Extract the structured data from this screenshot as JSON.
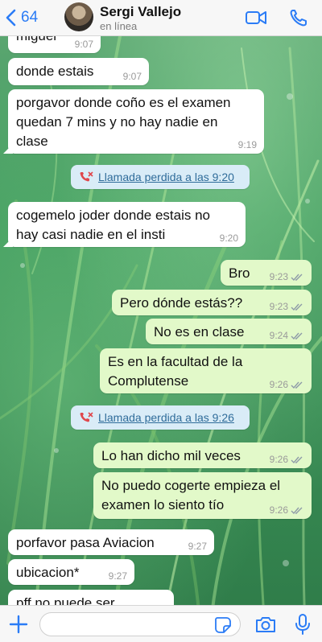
{
  "header": {
    "back_count": "64",
    "contact_name": "Sergi Vallejo",
    "status": "en línea"
  },
  "messages": [
    {
      "text": "miguel",
      "time": "9:07",
      "dir": "in"
    },
    {
      "text": "donde estais",
      "time": "9:07",
      "dir": "in"
    },
    {
      "lines": [
        "porgavor donde coño es el examen",
        "quedan 7 mins y no hay nadie en",
        "clase"
      ],
      "time": "9:19",
      "dir": "in"
    },
    {
      "text": "Llamada perdida a las 9:20",
      "type": "missed-call"
    },
    {
      "lines": [
        "cogemelo joder donde estais no",
        "hay casi nadie en el insti"
      ],
      "time": "9:20",
      "dir": "in"
    },
    {
      "text": "Bro",
      "time": "9:23",
      "dir": "out"
    },
    {
      "text": "Pero dónde estás??",
      "time": "9:23",
      "dir": "out"
    },
    {
      "text": "No es en clase",
      "time": "9:24",
      "dir": "out"
    },
    {
      "lines": [
        "Es en la facultad de la",
        "Complutense"
      ],
      "time": "9:26",
      "dir": "out"
    },
    {
      "text": "Llamada perdida a las 9:26",
      "type": "missed-call"
    },
    {
      "text": "Lo han dicho mil veces",
      "time": "9:26",
      "dir": "out"
    },
    {
      "lines": [
        "No puedo cogerte empieza el",
        "examen lo siento tío"
      ],
      "time": "9:26",
      "dir": "out"
    },
    {
      "text": "porfavor pasa Aviacion",
      "time": "9:27",
      "dir": "in"
    },
    {
      "text": "ubicacion*",
      "time": "9:27",
      "dir": "in"
    },
    {
      "text": "pff no puede ser",
      "dir": "in"
    }
  ],
  "footer": {
    "input_value": "",
    "input_placeholder": ""
  },
  "colors": {
    "accent": "#2b7cf6",
    "outgoing_bubble": "#e2f9c9",
    "incoming_bubble": "#ffffff",
    "read_ticks": "#8e9ba8",
    "missed_call_icon": "#e0474c"
  },
  "icons": {
    "back": "chevron-left-icon",
    "video": "video-call-icon",
    "call": "phone-icon",
    "missed_call": "missed-call-icon",
    "attach": "plus-icon",
    "sticker": "sticker-icon",
    "camera": "camera-icon",
    "mic": "microphone-icon"
  }
}
